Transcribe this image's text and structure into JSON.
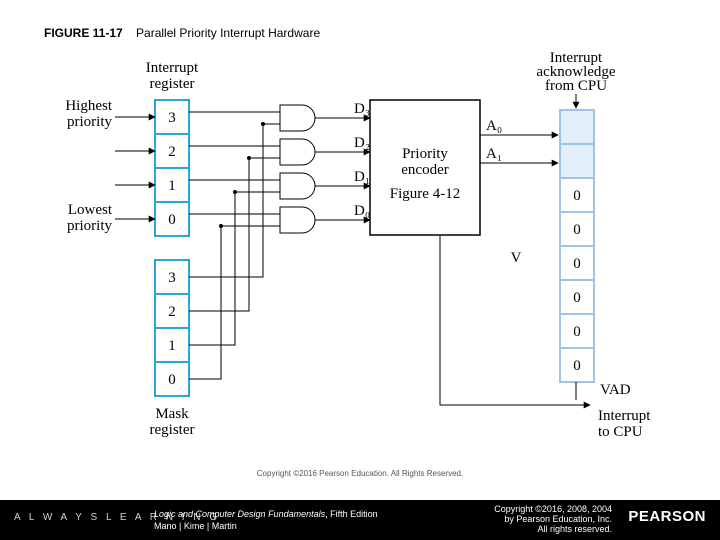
{
  "title": {
    "fignum": "FIGURE 11-17",
    "caption": "Parallel Priority Interrupt Hardware"
  },
  "labels": {
    "interrupt_register": "Interrupt\nregister",
    "mask_register": "Mask\nregister",
    "highest_priority": "Highest\npriority",
    "lowest_priority": "Lowest\npriority",
    "encoder_title": "Priority\nencoder",
    "encoder_ref": "Figure 4-12",
    "ack": "Interrupt\nacknowledge\nfrom CPU",
    "vad": "VAD",
    "to_cpu": "Interrupt\nto CPU",
    "V": "V"
  },
  "interrupt_register": [
    "3",
    "2",
    "1",
    "0"
  ],
  "mask_register": [
    "3",
    "2",
    "1",
    "0"
  ],
  "encoder_inputs": [
    "D₃",
    "D₂",
    "D₁",
    "D₀"
  ],
  "encoder_outputs": [
    "A₀",
    "A₁"
  ],
  "vad_cells": [
    "",
    "",
    "",
    "0",
    "0",
    "0",
    "0",
    "0",
    "0"
  ],
  "microcopy": "Copyright ©2016 Pearson Education. All Rights Reserved.",
  "footer": {
    "always": "A L W A Y S  L E A R N I N G",
    "book_title": "Logic and Computer Design Fundamentals",
    "book_edition": ", Fifth Edition",
    "authors": "Mano | Kime | Martin",
    "copyright_l1": "Copyright ©2016, 2008, 2004",
    "copyright_l2": "by Pearson Education, Inc.",
    "copyright_l3": "All rights reserved.",
    "pearson": "PEARSON"
  }
}
